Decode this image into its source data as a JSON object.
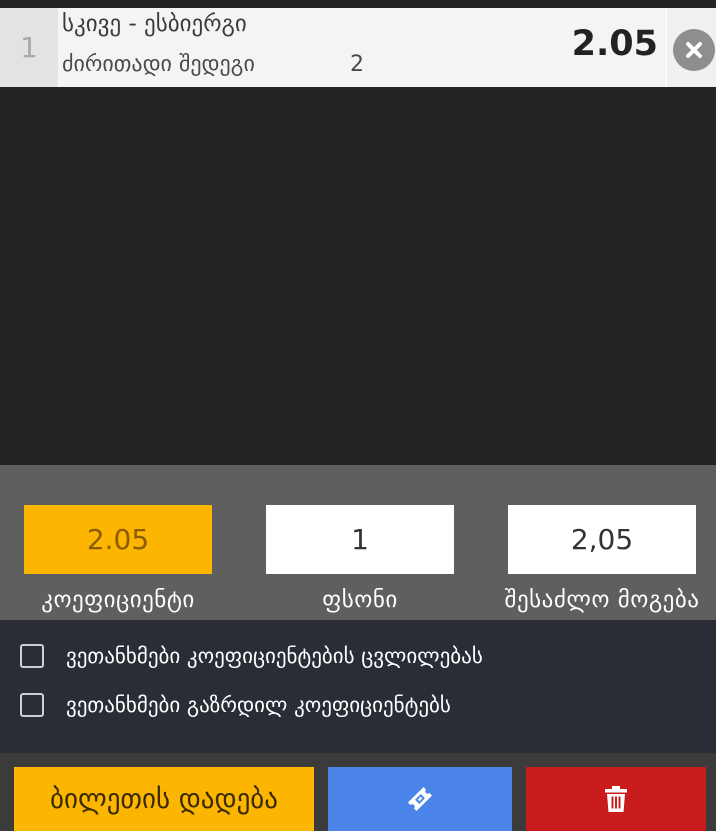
{
  "bet": {
    "index": "1",
    "event": "სკივე - ესბიერგი",
    "market": "ძირითადი შედეგი",
    "outcome": "2",
    "odds": "2.05"
  },
  "stake_panel": {
    "odds_value": "2.05",
    "odds_label": "კოეფიციენტი",
    "stake_value": "1",
    "stake_label": "ფსონი",
    "possible_win_value": "2,05",
    "possible_win_label": "შესაძლო მოგება"
  },
  "agreements": [
    {
      "label": "ვეთანხმები კოეფიციენტების ცვლილებას",
      "checked": false
    },
    {
      "label": "ვეთანხმები გაზრდილ კოეფიციენტებს",
      "checked": false
    }
  ],
  "actions": {
    "place_bet_label": "ბილეთის დადება",
    "ticket_icon": "ticket-icon",
    "clear_icon": "trash-icon"
  },
  "colors": {
    "accent": "#fcb500",
    "ticket_button": "#4a84e8",
    "clear_button": "#c81c1c"
  }
}
